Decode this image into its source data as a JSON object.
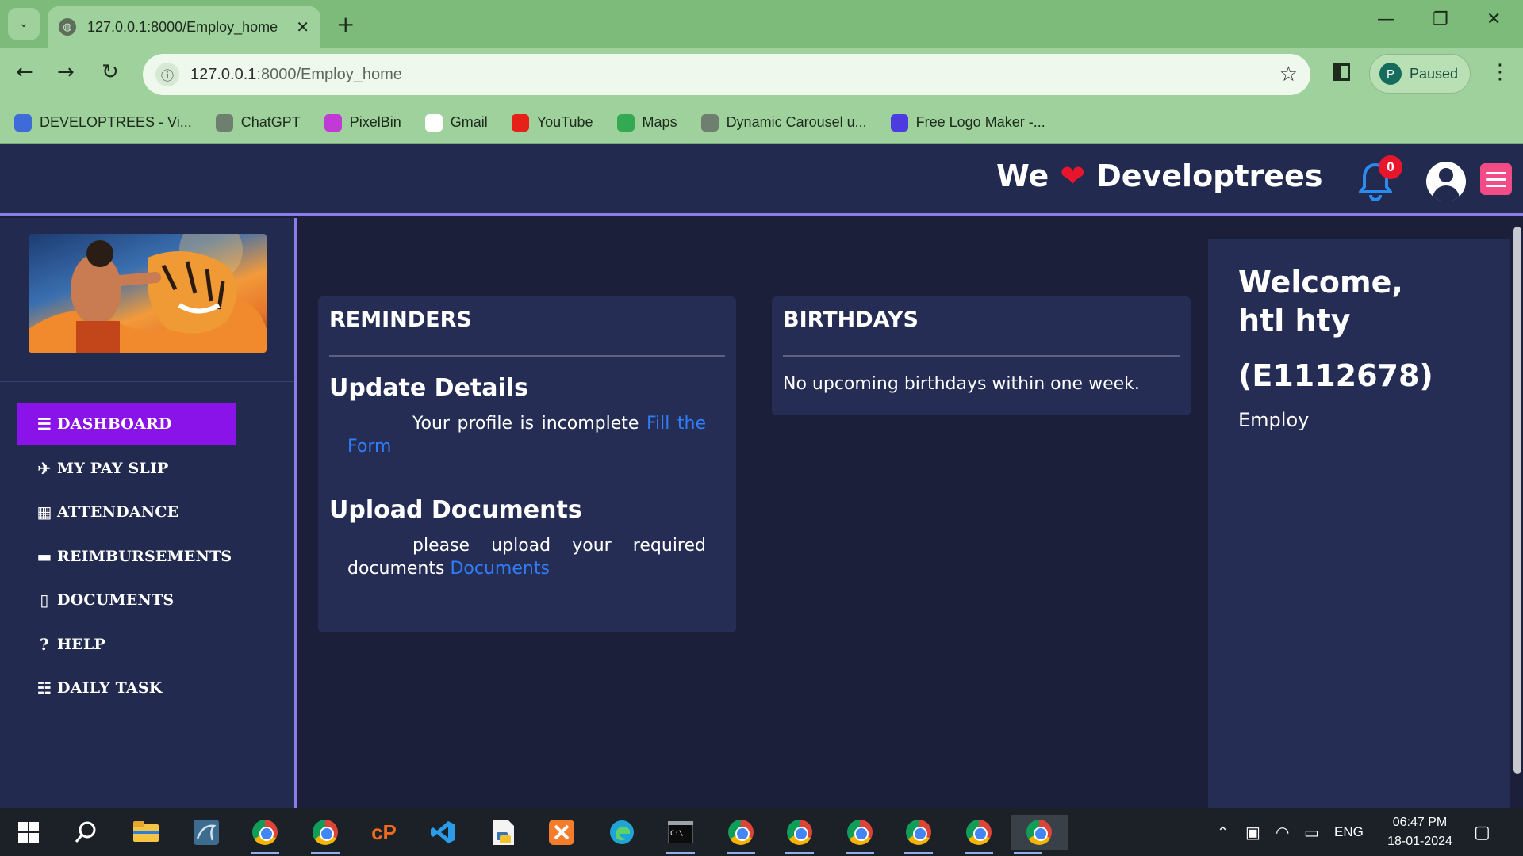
{
  "browser": {
    "tab_title": "127.0.0.1:8000/Employ_home",
    "url_host": "127.0.0.1",
    "url_rest": ":8000/Employ_home",
    "profile_initial": "P",
    "profile_status": "Paused",
    "bookmarks": [
      {
        "label": "DEVELOPTREES - Vi...",
        "icon": "developtrees-icon",
        "color": "#3d6bd8"
      },
      {
        "label": "ChatGPT",
        "icon": "chatgpt-icon",
        "color": "#6f7f6f"
      },
      {
        "label": "PixelBin",
        "icon": "pixelbin-icon",
        "color": "#c23ad6"
      },
      {
        "label": "Gmail",
        "icon": "google-icon",
        "color": "#ffffff"
      },
      {
        "label": "YouTube",
        "icon": "youtube-icon",
        "color": "#e62117"
      },
      {
        "label": "Maps",
        "icon": "maps-icon",
        "color": "#34a853"
      },
      {
        "label": "Dynamic Carousel u...",
        "icon": "chatgpt-icon",
        "color": "#6f7f6f"
      },
      {
        "label": "Free Logo Maker -...",
        "icon": "logo-maker-icon",
        "color": "#4b3be0"
      }
    ]
  },
  "navbar": {
    "brand_prefix": "We",
    "brand_heart": "❤",
    "brand_name": "Developtrees",
    "notification_count": "0"
  },
  "sidebar": {
    "items": [
      {
        "label": "DASHBOARD",
        "icon": "bars-icon",
        "glyph": "☰",
        "active": true
      },
      {
        "label": "MY PAY SLIP",
        "icon": "paper-plane-icon",
        "glyph": "✈",
        "active": false
      },
      {
        "label": "ATTENDANCE",
        "icon": "calendar-icon",
        "glyph": "▦",
        "active": false
      },
      {
        "label": "REIMBURSEMENTS",
        "icon": "credit-card-icon",
        "glyph": "▬",
        "active": false
      },
      {
        "label": "DOCUMENTS",
        "icon": "file-icon",
        "glyph": "▯",
        "active": false
      },
      {
        "label": "HELP",
        "icon": "question-circle-icon",
        "glyph": "?",
        "active": false
      },
      {
        "label": "DAILY TASK",
        "icon": "list-check-icon",
        "glyph": "☷",
        "active": false
      }
    ]
  },
  "reminders": {
    "title": "REMINDERS",
    "items": [
      {
        "title": "Update Details",
        "text": "Your profile is incomplete",
        "link": "Fill the Form"
      },
      {
        "title": "Upload Documents",
        "text": "please upload your required documents",
        "link": "Documents"
      }
    ]
  },
  "birthdays": {
    "title": "BIRTHDAYS",
    "message": "No upcoming birthdays within one week."
  },
  "welcome": {
    "label": "Welcome,",
    "name": "htl hty",
    "employee_id": "(E1112678)",
    "role": "Employ"
  },
  "taskbar": {
    "language": "ENG",
    "time": "06:47 PM",
    "date": "18-01-2024"
  },
  "colors": {
    "page_bg": "#1b1f3a",
    "panel_bg": "#262d55",
    "active_nav": "#8a13ea",
    "link": "#2f7ef7",
    "accent_border": "#8b7de8"
  }
}
